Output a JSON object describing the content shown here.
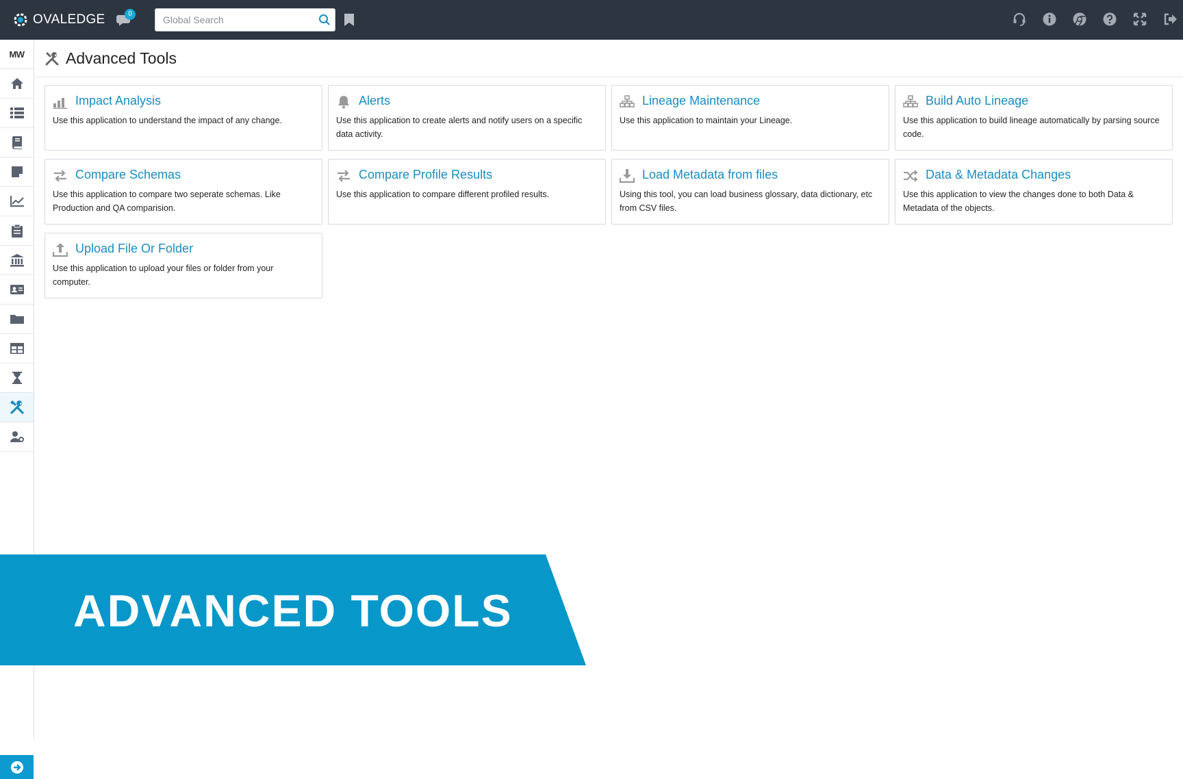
{
  "app": {
    "brand": "OVALEDGE",
    "brand_accent": "#1aa6d8"
  },
  "topbar": {
    "chat_badge": "0",
    "search": {
      "placeholder": "Global Search",
      "value": ""
    },
    "icons": [
      "headset-icon",
      "info-icon",
      "chrome-icon",
      "help-icon",
      "fullscreen-icon",
      "logout-icon"
    ]
  },
  "sidebar": {
    "user_initials": "MW",
    "items": [
      "home-icon",
      "list-icon",
      "book-icon",
      "note-icon",
      "chart-icon",
      "clipboard-icon",
      "bank-icon",
      "id-card-icon",
      "folder-icon",
      "table-icon",
      "hourglass-icon",
      "tools-icon",
      "user-settings-icon"
    ],
    "active": "tools-icon"
  },
  "page": {
    "title": "Advanced Tools"
  },
  "cards": [
    {
      "icon": "bar-chart-icon",
      "title": "Impact Analysis",
      "desc": "Use this application to understand the impact of any change."
    },
    {
      "icon": "bell-icon",
      "title": "Alerts",
      "desc": "Use this application to create alerts and notify users on a specific data activity."
    },
    {
      "icon": "sitemap-icon",
      "title": "Lineage Maintenance",
      "desc": "Use this application to maintain your Lineage."
    },
    {
      "icon": "sitemap-icon",
      "title": "Build Auto Lineage",
      "desc": "Use this application to build lineage automatically by parsing source code."
    },
    {
      "icon": "exchange-icon",
      "title": "Compare Schemas",
      "desc": "Use this application to compare two seperate schemas. Like Production and QA comparision."
    },
    {
      "icon": "exchange-icon",
      "title": "Compare Profile Results",
      "desc": "Use this application to compare different profiled results."
    },
    {
      "icon": "download-icon",
      "title": "Load Metadata from files",
      "desc": "Using this tool, you can load business glossary, data dictionary, etc from CSV files."
    },
    {
      "icon": "shuffle-icon",
      "title": "Data & Metadata Changes",
      "desc": "Use this application to view the changes done to both Data & Metadata of the objects."
    },
    {
      "icon": "upload-icon",
      "title": "Upload File Or Folder",
      "desc": "Use this application to upload your files or folder from your computer."
    }
  ],
  "banner": {
    "text": "ADVANCED TOOLS",
    "color": "#0797c9"
  }
}
